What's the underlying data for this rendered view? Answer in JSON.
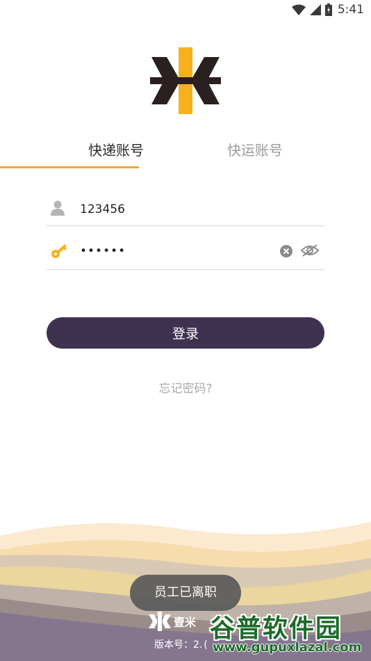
{
  "status_bar": {
    "time": "5:41",
    "icons": [
      "wifi-icon",
      "signal-icon",
      "battery-icon"
    ]
  },
  "tabs": [
    {
      "label": "快递账号",
      "active": true
    },
    {
      "label": "快运账号",
      "active": false
    }
  ],
  "form": {
    "username": {
      "value": "123456",
      "icon": "user-icon"
    },
    "password": {
      "value": "••••••",
      "icon": "key-icon"
    }
  },
  "login_button": {
    "label": "登录"
  },
  "forgot_password": {
    "label": "忘记密码?"
  },
  "toast": {
    "message": "员工已离职"
  },
  "footer": {
    "brand": "壹米",
    "version_label": "版本号：2.",
    "version_value": "("
  },
  "watermark": {
    "title": "谷普软件园",
    "url": "www.gupuxlazal.com"
  },
  "colors": {
    "accent": "#f4a736",
    "button": "#3e3250",
    "logo_dark": "#2a2020",
    "logo_yellow": "#f5b21b"
  }
}
